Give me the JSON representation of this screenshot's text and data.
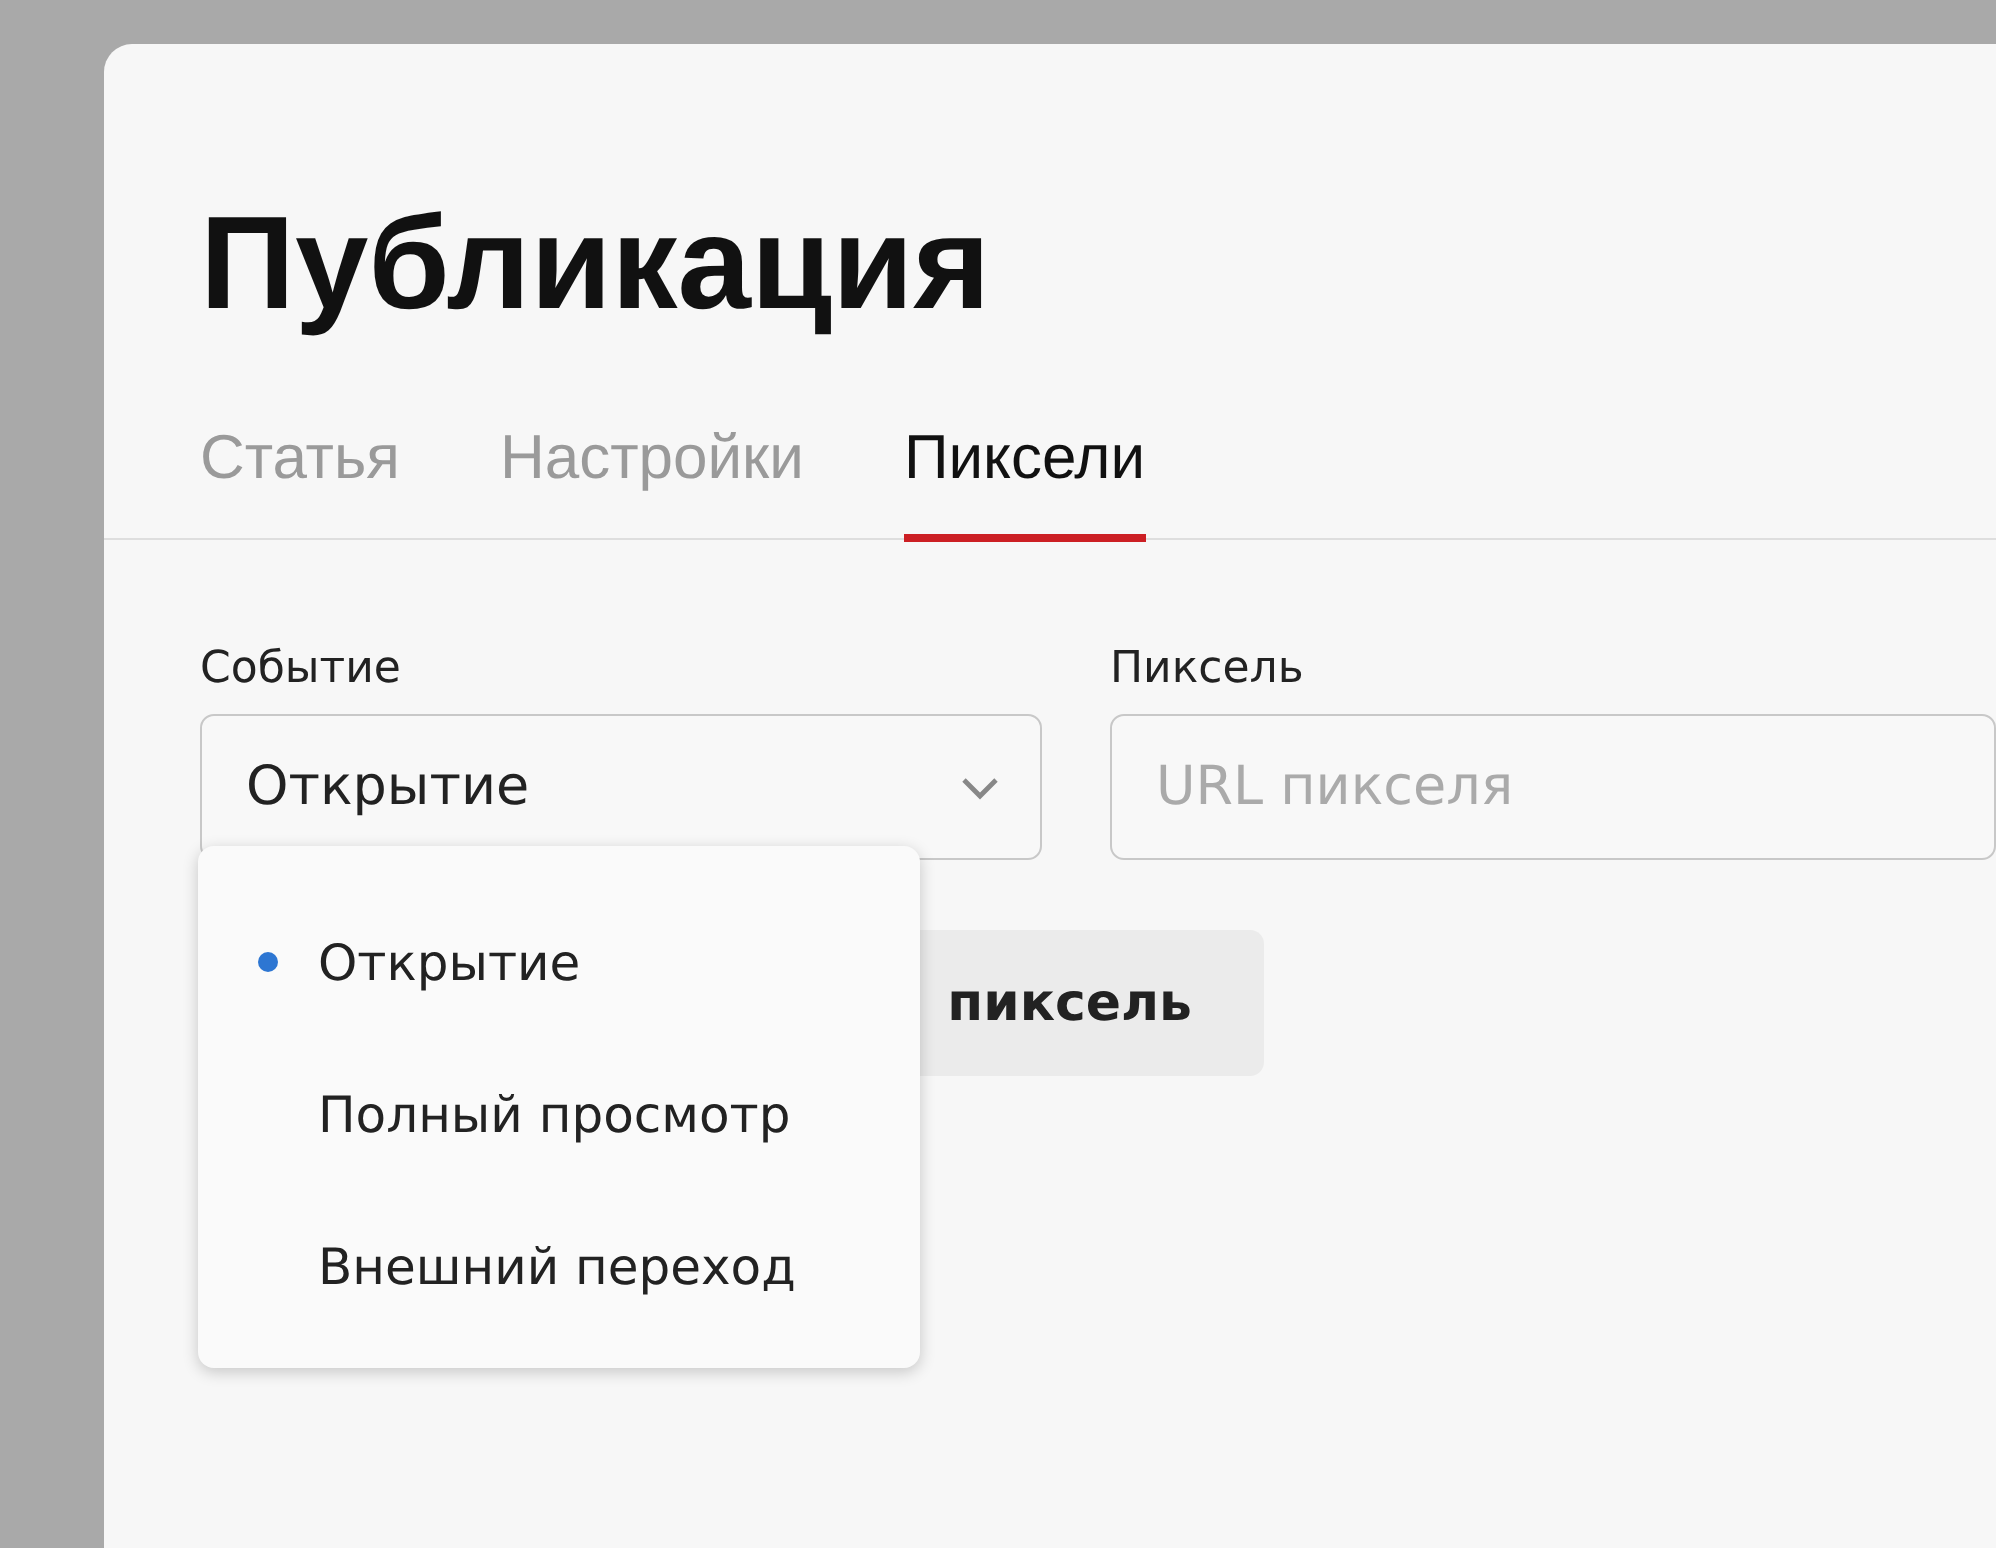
{
  "page": {
    "title": "Публикация"
  },
  "tabs": [
    {
      "label": "Статья",
      "selected": false
    },
    {
      "label": "Настройки",
      "selected": false
    },
    {
      "label": "Пиксели",
      "selected": true
    }
  ],
  "form": {
    "event": {
      "label": "Событие",
      "value": "Открытие",
      "expanded": true,
      "options": [
        {
          "label": "Открытие",
          "selected": true
        },
        {
          "label": "Полный просмотр",
          "selected": false
        },
        {
          "label": "Внешний переход",
          "selected": false
        }
      ]
    },
    "pixel": {
      "label": "Пиксель",
      "placeholder": "URL пикселя"
    },
    "add_button": {
      "label": "пиксель"
    }
  }
}
